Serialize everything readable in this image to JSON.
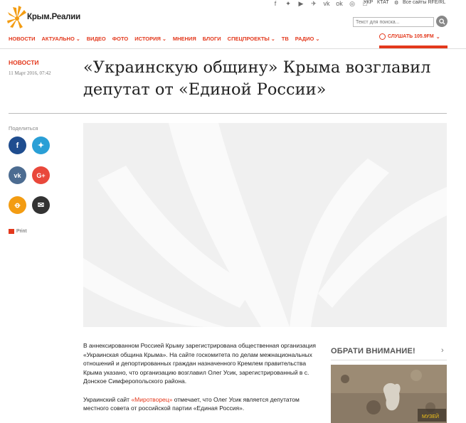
{
  "brand": {
    "name": "Крым.Реалии"
  },
  "header": {
    "social_icons": [
      "facebook-icon",
      "twitter-icon",
      "youtube-icon",
      "telegram-icon",
      "vk-icon",
      "odnoklassniki-icon",
      "rss-icon",
      "instagram-icon"
    ],
    "languages": [
      "УКР",
      "КТАТ"
    ],
    "rfe_link": "Все сайты RFE/RL",
    "search_placeholder": "Текст для поиска..."
  },
  "nav": {
    "items": [
      {
        "label": "НОВОСТИ",
        "dropdown": false
      },
      {
        "label": "АКТУАЛЬНО",
        "dropdown": true
      },
      {
        "label": "ВИДЕО",
        "dropdown": false
      },
      {
        "label": "ФОТО",
        "dropdown": false
      },
      {
        "label": "ИСТОРИЯ",
        "dropdown": true
      },
      {
        "label": "МНЕНИЯ",
        "dropdown": false
      },
      {
        "label": "БЛОГИ",
        "dropdown": false
      },
      {
        "label": "СПЕЦПРОЕКТЫ",
        "dropdown": true
      },
      {
        "label": "ТВ",
        "dropdown": false
      },
      {
        "label": "РАДИО",
        "dropdown": true
      }
    ],
    "listen_label": "СЛУШАТЬ 105.9FM"
  },
  "article": {
    "category": "НОВОСТИ",
    "date": "11 Март 2016, 07:42",
    "title": "«Украинскую общину» Крыма возглавил депутат от «Единой России»",
    "paragraph1": "В аннексированном Россией Крыму зарегистрирована общественная организация «Украинская община Крыма». На сайте госкомитета по делам межнациональных отношений и депортированных граждан назначенного Кремлем правительства Крыма указано, что организацию возглавил Олег Усик, зарегистрированный в с. Донское Симферопольского района.",
    "paragraph2_before": "Украинский сайт ",
    "paragraph2_link": "«Миротворец»",
    "paragraph2_after": " отмечает, что Олег Усик является депутатом местного совета от российской партии «Единая Россия»."
  },
  "share": {
    "label": "Поделиться",
    "print_label": "Print",
    "colors": {
      "facebook": "#1f4d8f",
      "twitter": "#2a9fd6",
      "vk": "#4c6c91",
      "gplus": "#e9483b",
      "ok": "#f39c12",
      "email": "#333333"
    }
  },
  "sidebar": {
    "title": "ОБРАТИ ВНИМАНИЕ!",
    "image_logo_text": "МУЗЕЙ"
  },
  "colors": {
    "accent": "#e3381c"
  }
}
